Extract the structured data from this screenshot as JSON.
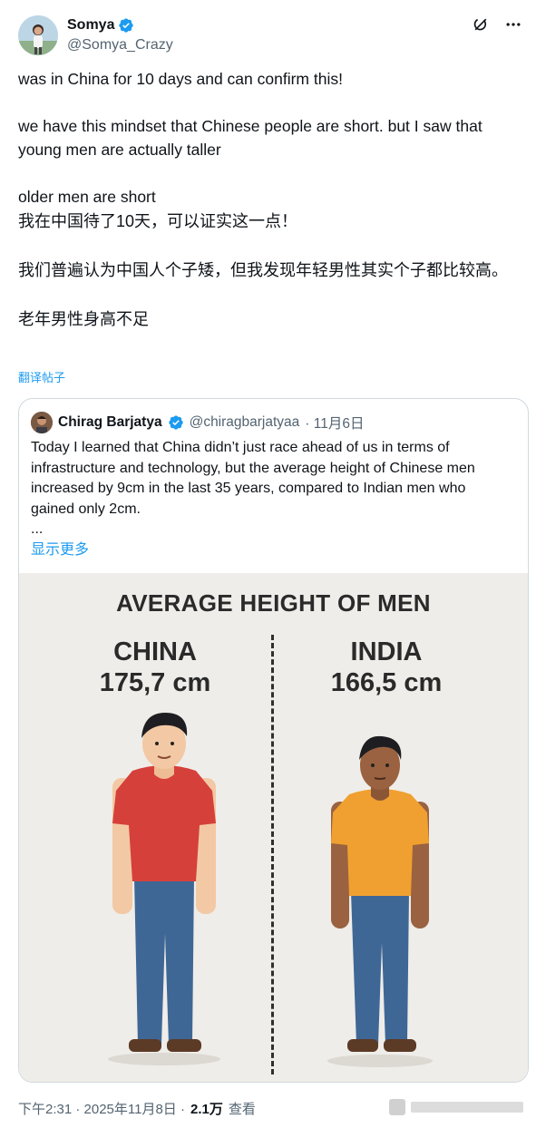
{
  "author": {
    "display_name": "Somya",
    "handle": "@Somya_Crazy",
    "avatar_icon": "avatar"
  },
  "header_icons": [
    "grok-icon",
    "more-icon"
  ],
  "tweet": {
    "lines_en": [
      "was in China for 10 days and can confirm this!",
      "we have this mindset that Chinese people are short. but I saw that young men are actually taller",
      "older men are short"
    ],
    "lines_cn": [
      "我在中国待了10天，可以证实这一点！",
      "我们普遍认为中国人个子矮，但我发现年轻男性其实个子都比较高。",
      "老年男性身高不足"
    ],
    "translate_label": "翻译帖子"
  },
  "quote": {
    "display_name": "Chirag Barjatya",
    "handle": "@chiragbarjatyaa",
    "date": "· 11月6日",
    "text": "Today I learned that China didn’t just race ahead of us in terms of infrastructure and technology, but the average height of Chinese men increased by 9cm in the last 35 years, compared to Indian men who gained only 2cm.",
    "ellipsis": "...",
    "show_more": "显示更多",
    "image": {
      "title": "AVERAGE HEIGHT OF MEN",
      "left": {
        "country": "CHINA",
        "height": "175,7 cm",
        "shirt_color": "#d6403a"
      },
      "right": {
        "country": "INDIA",
        "height": "166,5 cm",
        "shirt_color": "#f0a030"
      }
    }
  },
  "footer": {
    "time": "下午2:31 · 2025年11月8日 ·",
    "views": "2.1万",
    "views_label": "查看"
  },
  "colors": {
    "link": "#1d9bf0",
    "muted": "#536471",
    "verified": "#1d9bf0"
  }
}
